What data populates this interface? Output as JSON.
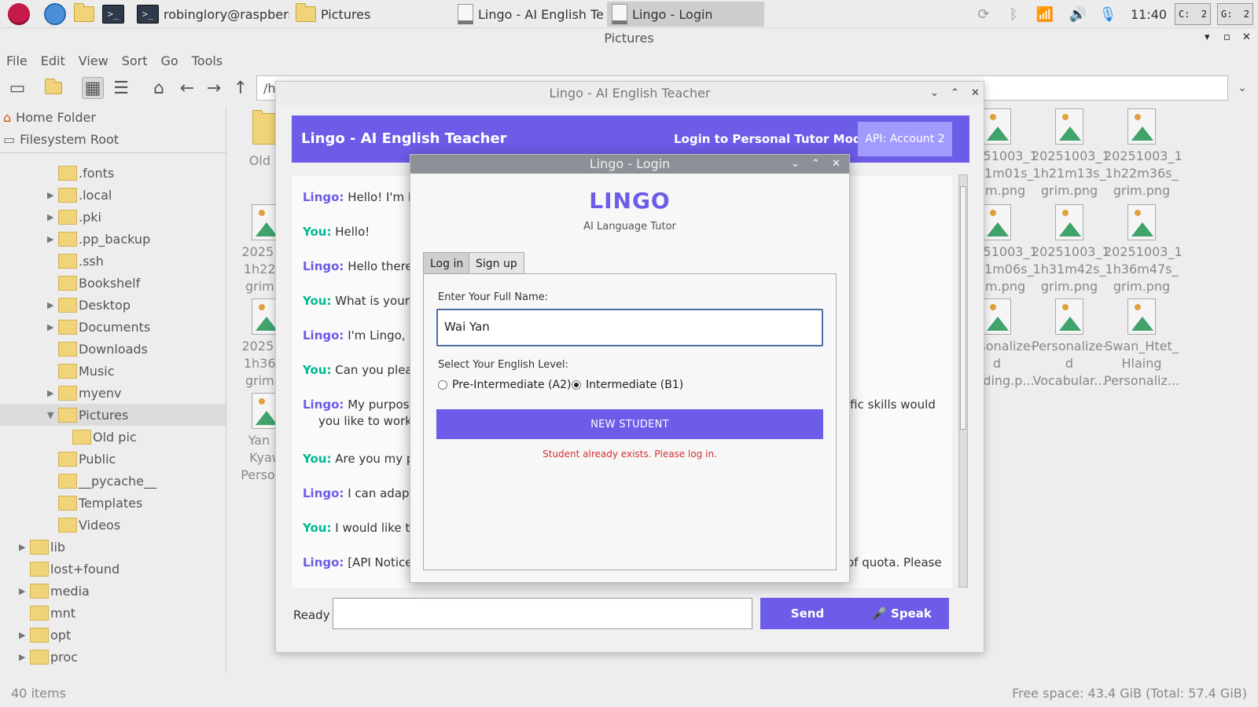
{
  "taskbar": {
    "buttons": [
      {
        "label": "robinglory@raspberr..."
      },
      {
        "label": "Pictures"
      },
      {
        "label": "Lingo - AI English Te..."
      },
      {
        "label": "Lingo - Login"
      }
    ],
    "clock": "11:40",
    "cpu_label": "C:",
    "cpu_value": "2",
    "gpu_label": "G:",
    "gpu_value": "2"
  },
  "file_manager": {
    "window_title": "Pictures",
    "menu": [
      "File",
      "Edit",
      "View",
      "Sort",
      "Go",
      "Tools"
    ],
    "path": "/h",
    "places": [
      "Home Folder",
      "Filesystem Root"
    ],
    "tree": [
      ".fonts",
      ".local",
      ".pki",
      ".pp_backup",
      ".ssh",
      "Bookshelf",
      "Desktop",
      "Documents",
      "Downloads",
      "Music",
      "myenv",
      "Pictures",
      "Old pic",
      "Public",
      "__pycache__",
      "Templates",
      "Videos",
      "lib",
      "lost+found",
      "media",
      "mnt",
      "opt",
      "proc"
    ],
    "files": [
      {
        "l1": "Old p",
        "l2": "",
        "l3": ""
      },
      {
        "l1": "202510",
        "l2": "1h22m",
        "l3": "grim.p"
      },
      {
        "l1": "202510",
        "l2": "1h36m",
        "l3": "grim.p"
      },
      {
        "l1": "Yan N",
        "l2": "Kyaw",
        "l3": "Persona"
      },
      {
        "l1": "20251003_1",
        "l2": "1h21m01s_",
        "l3": "grim.png"
      },
      {
        "l1": "20251003_1",
        "l2": "1h21m13s_",
        "l3": "grim.png"
      },
      {
        "l1": "20251003_1",
        "l2": "1h22m36s_",
        "l3": "grim.png"
      },
      {
        "l1": "20251003_1",
        "l2": "1h31m06s_",
        "l3": "grim.png"
      },
      {
        "l1": "20251003_1",
        "l2": "1h31m42s_",
        "l3": "grim.png"
      },
      {
        "l1": "20251003_1",
        "l2": "1h36m47s_",
        "l3": "grim.png"
      },
      {
        "l1": "Personalize-",
        "l2": "d",
        "l3": "Reading.p..."
      },
      {
        "l1": "Personalize-",
        "l2": "d",
        "l3": "Vocabular..."
      },
      {
        "l1": "Swan_Htet_",
        "l2": "Hlaing",
        "l3": "Personaliz..."
      }
    ],
    "status_items": "40 items",
    "status_free": "Free space: 43.4 GiB (Total: 57.4 GiB)"
  },
  "lingo": {
    "window_title": "Lingo - AI English Teacher",
    "header_title": "Lingo - AI English Teacher",
    "login_link": "Login to Personal Tutor Mode",
    "api_button": "API: Account 2",
    "messages": [
      {
        "who": "Lingo:",
        "text": "Hello! I'm Lin"
      },
      {
        "who": "You:",
        "text": "Hello!"
      },
      {
        "who": "Lingo:",
        "text": "Hello there! I"
      },
      {
        "who": "You:",
        "text": "What is your n"
      },
      {
        "who": "Lingo:",
        "text": "I'm Lingo, yo"
      },
      {
        "who": "You:",
        "text": "Can you please"
      },
      {
        "who": "Lingo:",
        "text": "My purpose",
        "tail": "ific skills would",
        "line2": "you like to work"
      },
      {
        "who": "You:",
        "text": "Are you my pe"
      },
      {
        "who": "Lingo:",
        "text": "I can adapt to"
      },
      {
        "who": "You:",
        "text": "I would like th"
      },
      {
        "who": "Lingo:",
        "text": "[API Notice]",
        "tail": "of quota. Please"
      }
    ],
    "status": "Ready",
    "send_label": "Send",
    "speak_label": "🎤 Speak"
  },
  "login_dialog": {
    "window_title": "Lingo - Login",
    "brand": "LINGO",
    "subtitle": "AI Language Tutor",
    "tabs": [
      "Log in",
      "Sign up"
    ],
    "name_label": "Enter Your Full Name:",
    "name_value": "Wai Yan",
    "level_label": "Select Your English Level:",
    "levels": [
      "Pre-Intermediate (A2)",
      "Intermediate (B1)"
    ],
    "selected_level": "Intermediate (B1)",
    "button": "NEW STUDENT",
    "error": "Student already exists. Please log in.",
    "colors": {
      "accent": "#6c5ce7",
      "error": "#d63031",
      "you": "#00b894"
    }
  }
}
